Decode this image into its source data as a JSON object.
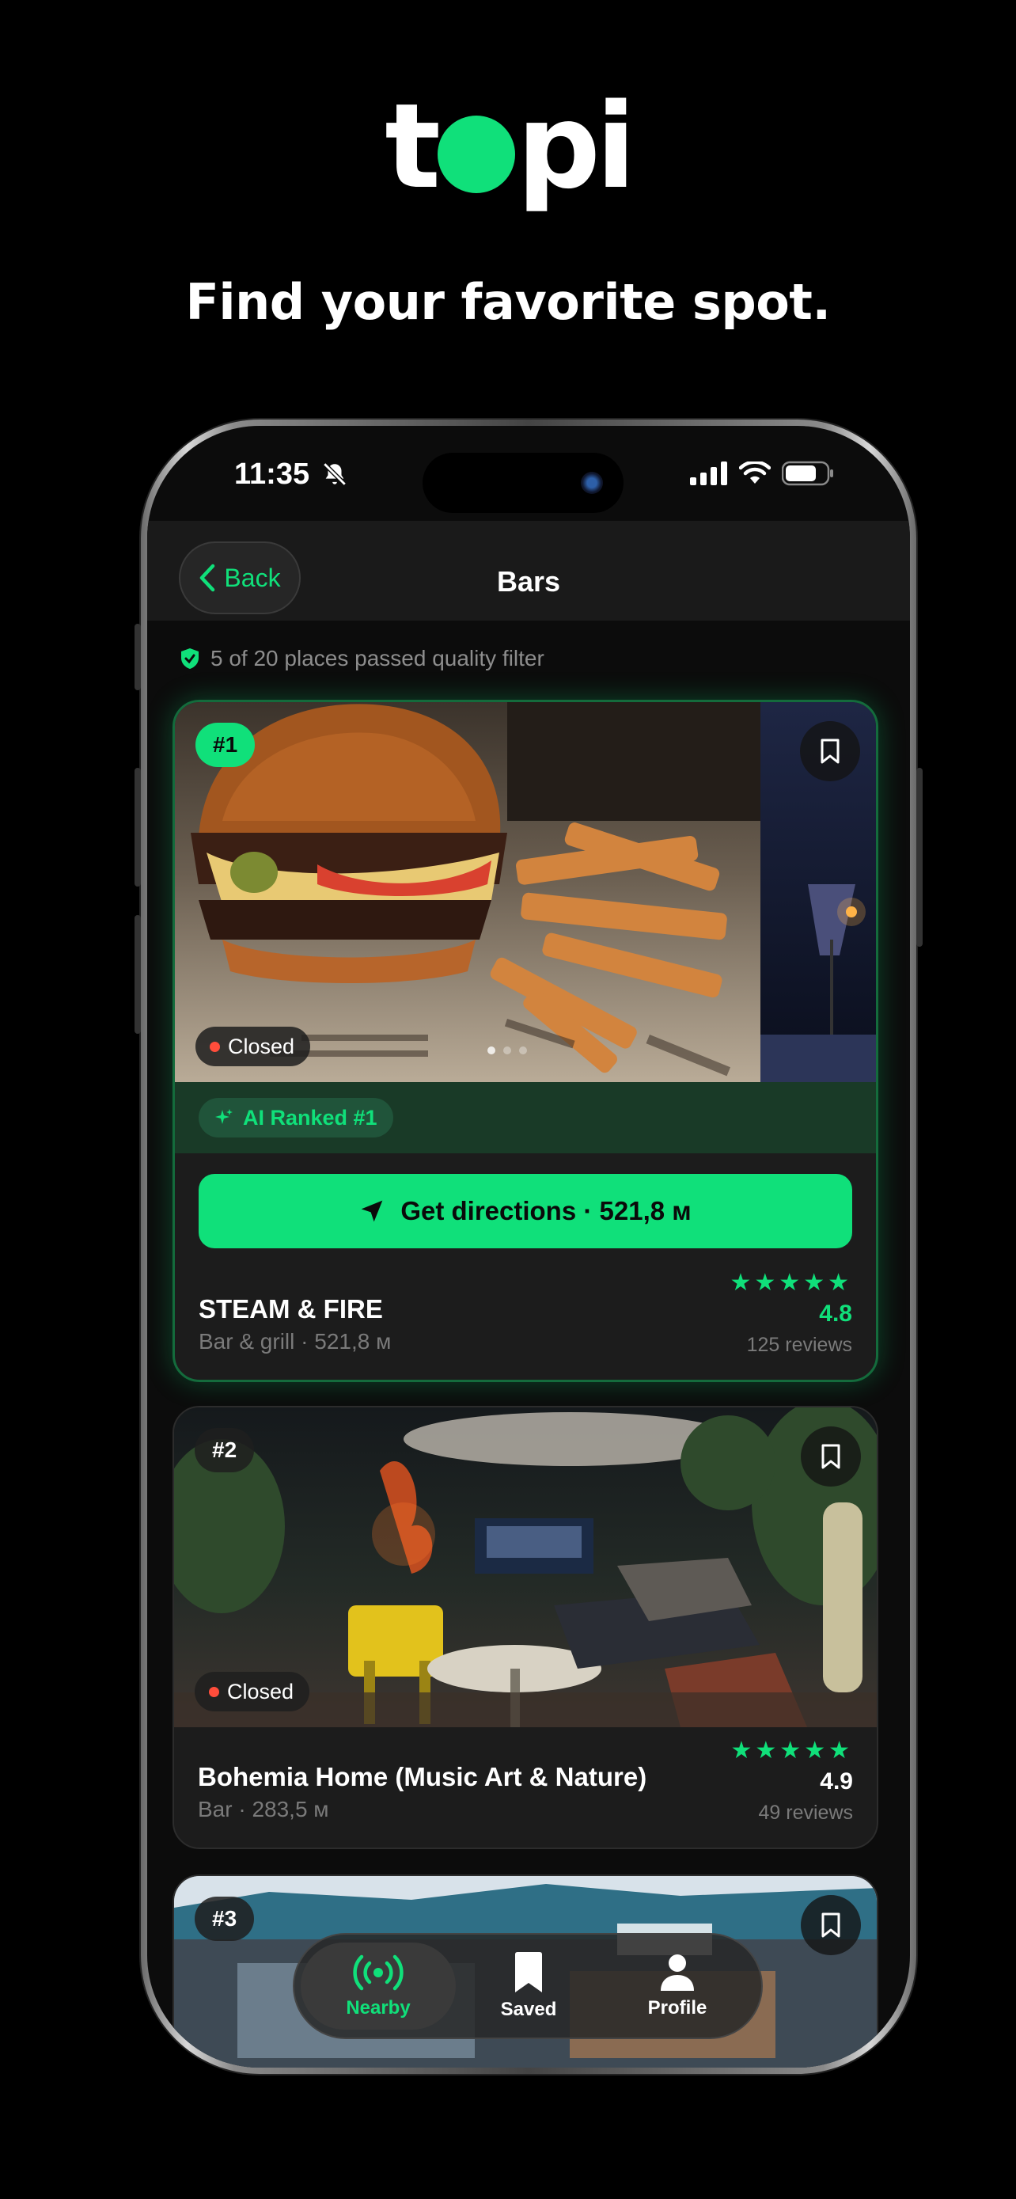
{
  "brand": {
    "logo_prefix": "t",
    "logo_suffix": "pi",
    "tagline": "Find your favorite spot."
  },
  "colors": {
    "accent": "#10e07a",
    "closed": "#ff4d3b",
    "background": "#000000"
  },
  "status_bar": {
    "time": "11:35",
    "icons": [
      "bell-slash-icon",
      "signal-icon",
      "wifi-icon",
      "battery-icon"
    ]
  },
  "nav": {
    "back_label": "Back",
    "title": "Bars"
  },
  "filter_note": "5 of 20 places passed quality filter",
  "places": [
    {
      "rank": "#1",
      "status": "Closed",
      "ai_badge": "AI Ranked #1",
      "directions_label": "Get directions · 521,8 м",
      "name": "STEAM & FIRE",
      "meta": "Bar & grill · 521,8 м",
      "stars": "★★★★★",
      "rating": "4.8",
      "reviews": "125 reviews"
    },
    {
      "rank": "#2",
      "status": "Closed",
      "name": "Bohemia Home (Music Art & Nature)",
      "meta": "Bar · 283,5 м",
      "stars": "★★★★★",
      "rating": "4.9",
      "reviews": "49 reviews"
    },
    {
      "rank": "#3"
    }
  ],
  "tabs": [
    {
      "label": "Nearby",
      "icon": "broadcast-icon",
      "active": true
    },
    {
      "label": "Saved",
      "icon": "bookmark-icon",
      "active": false
    },
    {
      "label": "Profile",
      "icon": "person-icon",
      "active": false
    }
  ]
}
